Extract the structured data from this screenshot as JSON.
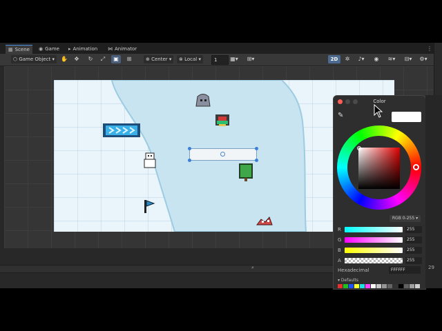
{
  "tabs": [
    {
      "label": "Scene",
      "icon": "scene-icon"
    },
    {
      "label": "Game",
      "icon": "game-icon"
    },
    {
      "label": "Animation",
      "icon": "animation-icon"
    },
    {
      "label": "Animator",
      "icon": "animator-icon"
    }
  ],
  "toolbar": {
    "game_object_label": "Game Object",
    "pivot_label": "Center",
    "space_label": "Local",
    "grid_snap_value": "1",
    "mode_2d": "2D"
  },
  "color_picker": {
    "title": "Color",
    "mode": "RGB 0-255",
    "channels": [
      {
        "label": "R",
        "value": "255",
        "color": "#00e5ff"
      },
      {
        "label": "G",
        "value": "255",
        "color": "#ff40ff"
      },
      {
        "label": "B",
        "value": "255",
        "color": "#ffff00"
      },
      {
        "label": "A",
        "value": "255",
        "color": "#ffffff"
      }
    ],
    "hex_label": "Hexadecimal",
    "hex_value": "FFFFFF",
    "defaults_label": "▾ Defaults",
    "current_color": "#ffffff",
    "palette": [
      "#e83030",
      "#20c020",
      "#2050ff",
      "#ffff30",
      "#20e0e0",
      "#ff40ff",
      "#ffffff",
      "#c8c8c8",
      "#969696",
      "#646464",
      "#323232",
      "#000000",
      "#606060",
      "#a0a0a0",
      "#d0d0d0"
    ]
  },
  "status": {
    "right_number": "29"
  }
}
